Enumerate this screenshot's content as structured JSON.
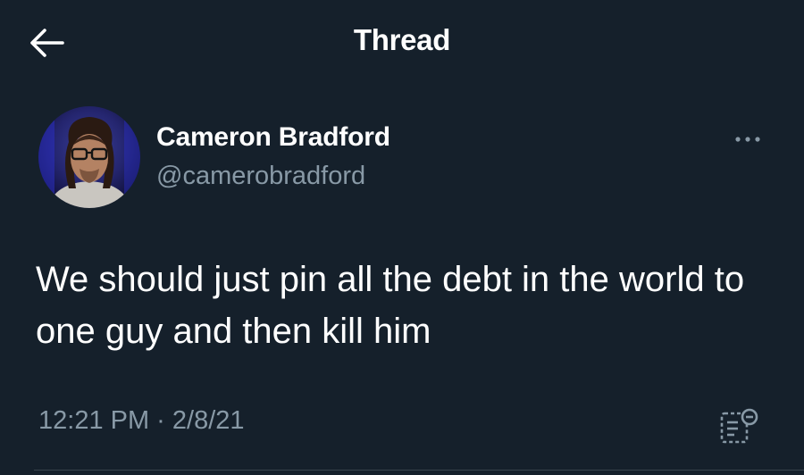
{
  "header": {
    "back_icon": "arrow-left-icon",
    "title": "Thread"
  },
  "tweet": {
    "author": {
      "display_name": "Cameron Bradford",
      "handle": "@camerobradford"
    },
    "more_icon": "more-horizontal-icon",
    "text": "We should just pin all the debt in the world to one guy and then kill him",
    "timestamp": "12:21 PM · 2/8/21",
    "analytics_icon": "analytics-icon"
  },
  "colors": {
    "background": "#15202b",
    "primary_text": "#ffffff",
    "secondary_text": "#8899a6",
    "divider": "#38444d"
  }
}
